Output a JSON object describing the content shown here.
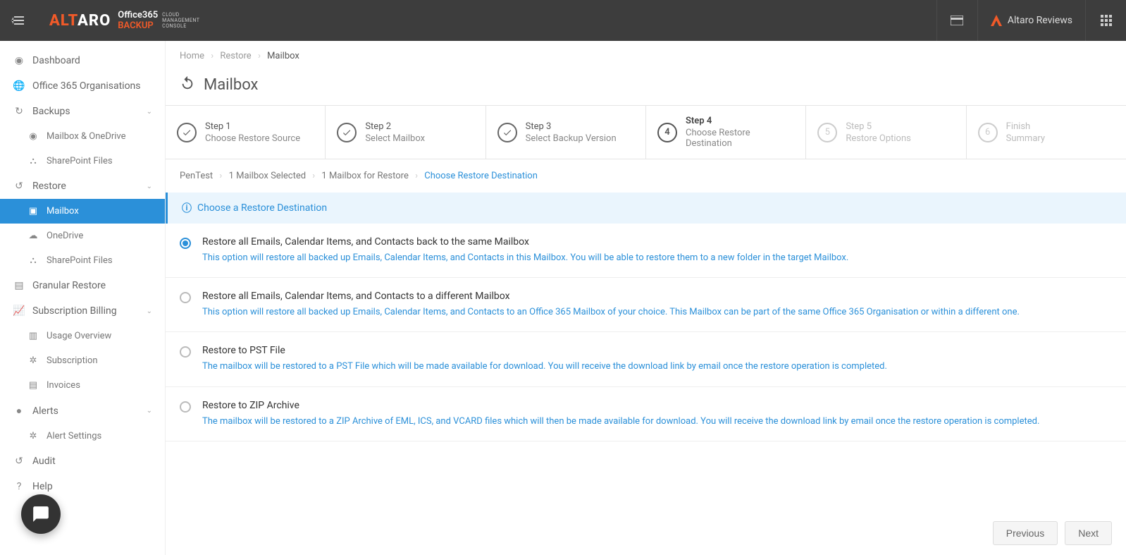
{
  "topbar": {
    "logo_main": "ALTARO",
    "logo_sub_line1a": "Office365",
    "logo_sub_line1b": "BACKUP",
    "logo_sub_line2": "CLOUD\nMANAGEMENT\nCONSOLE",
    "user_label": "Altaro Reviews"
  },
  "sidebar": {
    "items": [
      {
        "label": "Dashboard",
        "icon": "dashboard-icon"
      },
      {
        "label": "Office 365 Organisations",
        "icon": "globe-icon"
      },
      {
        "label": "Backups",
        "icon": "refresh-icon",
        "expandable": true
      },
      {
        "label": "Mailbox & OneDrive",
        "icon": "user-circle-icon",
        "sub": true
      },
      {
        "label": "SharePoint Files",
        "icon": "sitemap-icon",
        "sub": true
      },
      {
        "label": "Restore",
        "icon": "undo-icon",
        "expandable": true
      },
      {
        "label": "Mailbox",
        "icon": "archive-icon",
        "sub": true,
        "active": true
      },
      {
        "label": "OneDrive",
        "icon": "cloud-icon",
        "sub": true
      },
      {
        "label": "SharePoint Files",
        "icon": "sitemap-icon",
        "sub": true
      },
      {
        "label": "Granular Restore",
        "icon": "file-icon"
      },
      {
        "label": "Subscription Billing",
        "icon": "chart-icon",
        "expandable": true
      },
      {
        "label": "Usage Overview",
        "icon": "bar-chart-icon",
        "sub": true
      },
      {
        "label": "Subscription",
        "icon": "gear-icon",
        "sub": true
      },
      {
        "label": "Invoices",
        "icon": "document-icon",
        "sub": true
      },
      {
        "label": "Alerts",
        "icon": "exclaim-icon",
        "expandable": true
      },
      {
        "label": "Alert Settings",
        "icon": "gear-icon",
        "sub": true
      },
      {
        "label": "Audit",
        "icon": "history-icon"
      },
      {
        "label": "Help",
        "icon": "question-icon"
      }
    ]
  },
  "breadcrumb": {
    "home": "Home",
    "restore": "Restore",
    "mailbox": "Mailbox"
  },
  "page_title": "Mailbox",
  "wizard": [
    {
      "label": "Step 1",
      "sub": "Choose Restore Source",
      "state": "done"
    },
    {
      "label": "Step 2",
      "sub": "Select Mailbox",
      "state": "done"
    },
    {
      "label": "Step 3",
      "sub": "Select Backup Version",
      "state": "done"
    },
    {
      "label": "Step 4",
      "sub": "Choose Restore Destination",
      "state": "current"
    },
    {
      "label": "Step 5",
      "sub": "Restore Options",
      "state": "future",
      "num": "5"
    },
    {
      "label": "Finish",
      "sub": "Summary",
      "state": "future",
      "num": "6"
    }
  ],
  "sub_breadcrumb": {
    "a": "PenTest",
    "b": "1 Mailbox Selected",
    "c": "1 Mailbox for Restore",
    "d": "Choose Restore Destination"
  },
  "info_banner": "Choose a Restore Destination",
  "options": [
    {
      "title": "Restore all Emails, Calendar Items, and Contacts back to the same Mailbox",
      "desc": "This option will restore all backed up Emails, Calendar Items, and Contacts in this Mailbox. You will be able to restore them to a new folder in the target Mailbox.",
      "selected": true
    },
    {
      "title": "Restore all Emails, Calendar Items, and Contacts to a different Mailbox",
      "desc": "This option will restore all backed up Emails, Calendar Items, and Contacts to an Office 365 Mailbox of your choice. This Mailbox can be part of the same Office 365 Organisation or within a different one.",
      "selected": false
    },
    {
      "title": "Restore to PST File",
      "desc": "The mailbox will be restored to a PST File which will be made available for download. You will receive the download link by email once the restore operation is completed.",
      "selected": false
    },
    {
      "title": "Restore to ZIP Archive",
      "desc": "The mailbox will be restored to a ZIP Archive of EML, ICS, and VCARD files which will then be made available for download. You will receive the download link by email once the restore operation is completed.",
      "selected": false
    }
  ],
  "footer": {
    "prev": "Previous",
    "next": "Next"
  }
}
